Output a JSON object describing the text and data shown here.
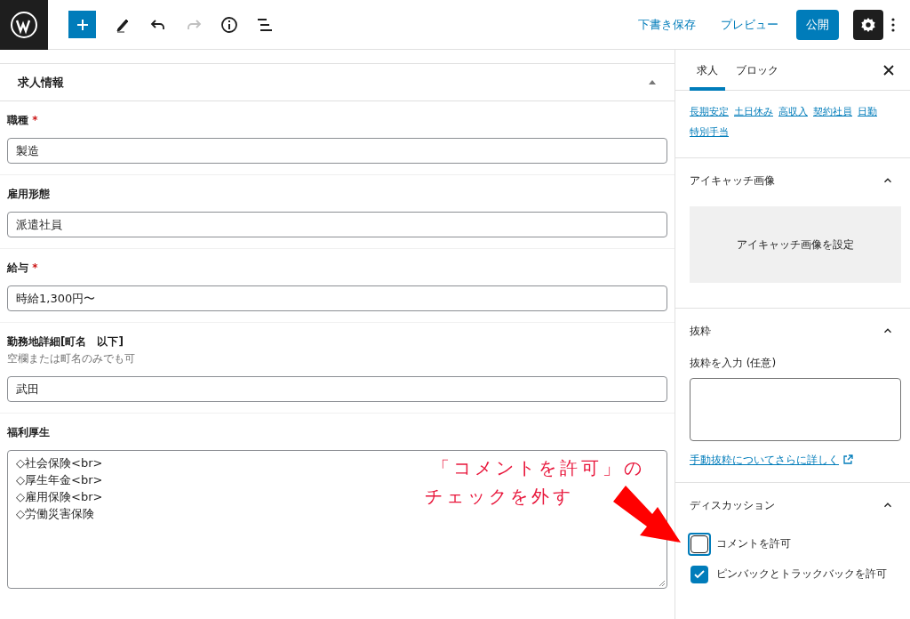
{
  "toolbar": {
    "save_draft": "下書き保存",
    "preview": "プレビュー",
    "publish": "公開",
    "settings_selected": true
  },
  "meta_box": {
    "title": "求人情報",
    "expanded": true,
    "fields": [
      {
        "kind": "input",
        "label": "職種",
        "mark": "*",
        "value": "製造"
      },
      {
        "kind": "input",
        "label": "雇用形態",
        "value": "派遣社員"
      },
      {
        "kind": "input",
        "label": "給与",
        "mark": "*",
        "value": "時給1,300円〜"
      },
      {
        "kind": "input",
        "label": "勤務地詳細[町名　以下]",
        "help": "空欄または町名のみでも可",
        "value": "武田"
      },
      {
        "kind": "textarea",
        "label": "福利厚生",
        "value": "◇社会保険<br>\n◇厚生年金<br>\n◇雇用保険<br>\n◇労働災害保険"
      }
    ]
  },
  "sidebar": {
    "tabs": [
      {
        "label": "求人",
        "selected": true
      },
      {
        "label": "ブロック",
        "selected": false
      }
    ],
    "tags": [
      "長期安定",
      "土日休み",
      "高収入",
      "契約社員",
      "日勤",
      "特別手当"
    ],
    "featured_image": {
      "title": "アイキャッチ画像",
      "expanded": true,
      "button": "アイキャッチ画像を設定"
    },
    "excerpt": {
      "title": "抜粋",
      "expanded": true,
      "label": "抜粋を入力 (任意)",
      "link": "手動抜粋についてさらに詳しく"
    },
    "discussion": {
      "title": "ディスカッション",
      "expanded": true,
      "options": [
        {
          "label": "コメントを許可",
          "checked": false,
          "focused": true
        },
        {
          "label": "ピンバックとトラックバックを許可",
          "checked": true,
          "focused": false
        }
      ]
    }
  },
  "annotation": {
    "lines": [
      "「コメントを許可」の",
      "チェックを外す"
    ]
  }
}
